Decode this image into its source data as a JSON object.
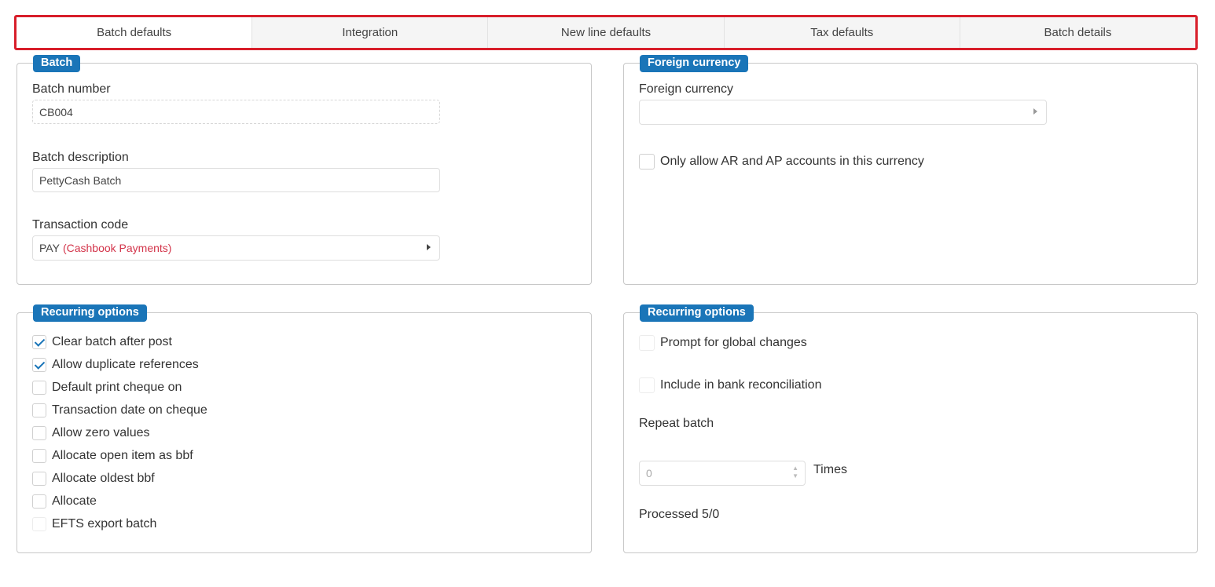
{
  "tabs": [
    {
      "label": "Batch defaults",
      "active": true
    },
    {
      "label": "Integration",
      "active": false
    },
    {
      "label": "New line defaults",
      "active": false
    },
    {
      "label": "Tax defaults",
      "active": false
    },
    {
      "label": "Batch details",
      "active": false
    }
  ],
  "batch_panel": {
    "legend": "Batch",
    "batch_number_label": "Batch number",
    "batch_number_value": "CB004",
    "batch_description_label": "Batch description",
    "batch_description_value": "PettyCash Batch",
    "transaction_code_label": "Transaction code",
    "transaction_code_value": "PAY",
    "transaction_code_desc": "(Cashbook Payments)"
  },
  "foreign_panel": {
    "legend": "Foreign currency",
    "foreign_currency_label": "Foreign currency",
    "foreign_currency_value": "",
    "only_allow_label": "Only allow AR and AP accounts in this currency"
  },
  "recurring_left": {
    "legend": "Recurring options",
    "options": [
      {
        "label": "Clear batch after post",
        "checked": true
      },
      {
        "label": "Allow duplicate references",
        "checked": true
      },
      {
        "label": "Default print cheque on",
        "checked": false
      },
      {
        "label": "Transaction date on cheque",
        "checked": false
      },
      {
        "label": "Allow zero values",
        "checked": false
      },
      {
        "label": "Allocate open item as bbf",
        "checked": false
      },
      {
        "label": "Allocate oldest bbf",
        "checked": false
      },
      {
        "label": "Allocate",
        "checked": false
      },
      {
        "label": "EFTS export batch",
        "checked": false
      }
    ]
  },
  "recurring_right": {
    "legend": "Recurring options",
    "prompt_global_label": "Prompt for global changes",
    "include_bank_label": "Include in bank reconciliation",
    "repeat_batch_label": "Repeat batch",
    "repeat_value": "0",
    "times_label": "Times",
    "processed_label": "Processed 5/0"
  },
  "colors": {
    "accent": "#1a75b8",
    "highlight_border": "#d81e2a",
    "code_desc": "#d3344a"
  }
}
